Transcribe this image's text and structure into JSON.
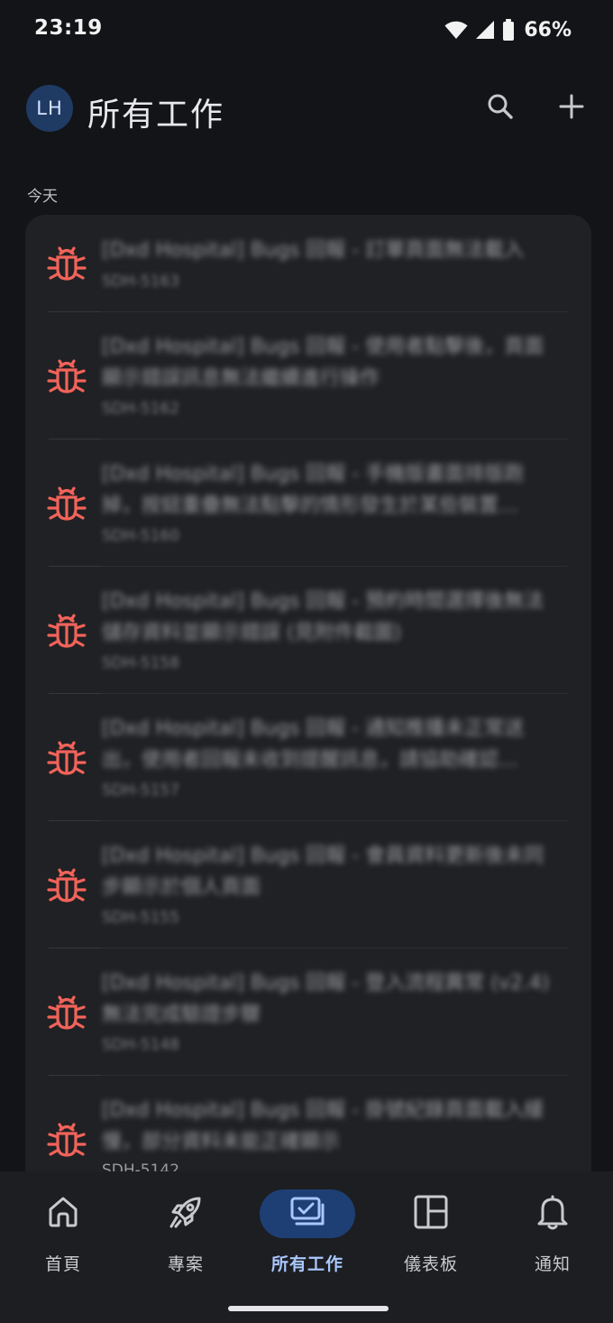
{
  "status_bar": {
    "time": "23:19",
    "battery": "66%",
    "icons": [
      "wifi-icon",
      "cell-signal-icon",
      "battery-icon"
    ]
  },
  "header": {
    "avatar_initials": "LH",
    "title": "所有工作",
    "actions": [
      "search-icon",
      "add-icon"
    ]
  },
  "section": {
    "label": "今天"
  },
  "items": [
    {
      "title": "[Dxd Hospital] Bugs 回報 - 訂單頁面無法載入",
      "key": "SDH-5163",
      "key_clear": false
    },
    {
      "title": "[Dxd Hospital] Bugs 回報 - 使用者點擊後，頁面顯示錯誤訊息無法繼續進行操作",
      "key": "SDH-5162",
      "key_clear": false
    },
    {
      "title": "[Dxd Hospital] Bugs 回報 - 手機版畫面排版跑掉，按鈕重疊無法點擊的情形發生於某些裝置…",
      "key": "SDH-5160",
      "key_clear": false
    },
    {
      "title": "[Dxd Hospital] Bugs 回報 - 預約時間選擇後無法儲存資料並顯示錯誤 (見附件截圖)",
      "key": "SDH-5158",
      "key_clear": false
    },
    {
      "title": "[Dxd Hospital] Bugs 回報 - 通知推播未正常送出，使用者回報未收到提醒訊息，請協助確認…",
      "key": "SDH-5157",
      "key_clear": false
    },
    {
      "title": "[Dxd Hospital] Bugs 回報 - 會員資料更新後未同步顯示於個人頁面",
      "key": "SDH-5155",
      "key_clear": false
    },
    {
      "title": "[Dxd Hospital] Bugs 回報 - 登入流程異常 (v2.4) 無法完成驗證步驟",
      "key": "SDH-5148",
      "key_clear": false
    },
    {
      "title": "[Dxd Hospital] Bugs 回報 - 掛號紀錄頁面載入緩慢，部分資料未能正確顯示",
      "key": "SDH-5142",
      "key_clear": true
    }
  ],
  "bottom_nav": {
    "items": [
      {
        "label": "首頁",
        "icon": "home-icon",
        "active": false
      },
      {
        "label": "專案",
        "icon": "rocket-icon",
        "active": false
      },
      {
        "label": "所有工作",
        "icon": "tasks-icon",
        "active": true
      },
      {
        "label": "儀表板",
        "icon": "dashboard-icon",
        "active": false
      },
      {
        "label": "通知",
        "icon": "bell-icon",
        "active": false
      }
    ]
  },
  "colors": {
    "background": "#131417",
    "card": "#202124",
    "bug_icon": "#f2635a",
    "active_nav_pill": "#1e3f74",
    "active_nav_label": "#a9c7ff",
    "avatar": "#1f3b64"
  }
}
